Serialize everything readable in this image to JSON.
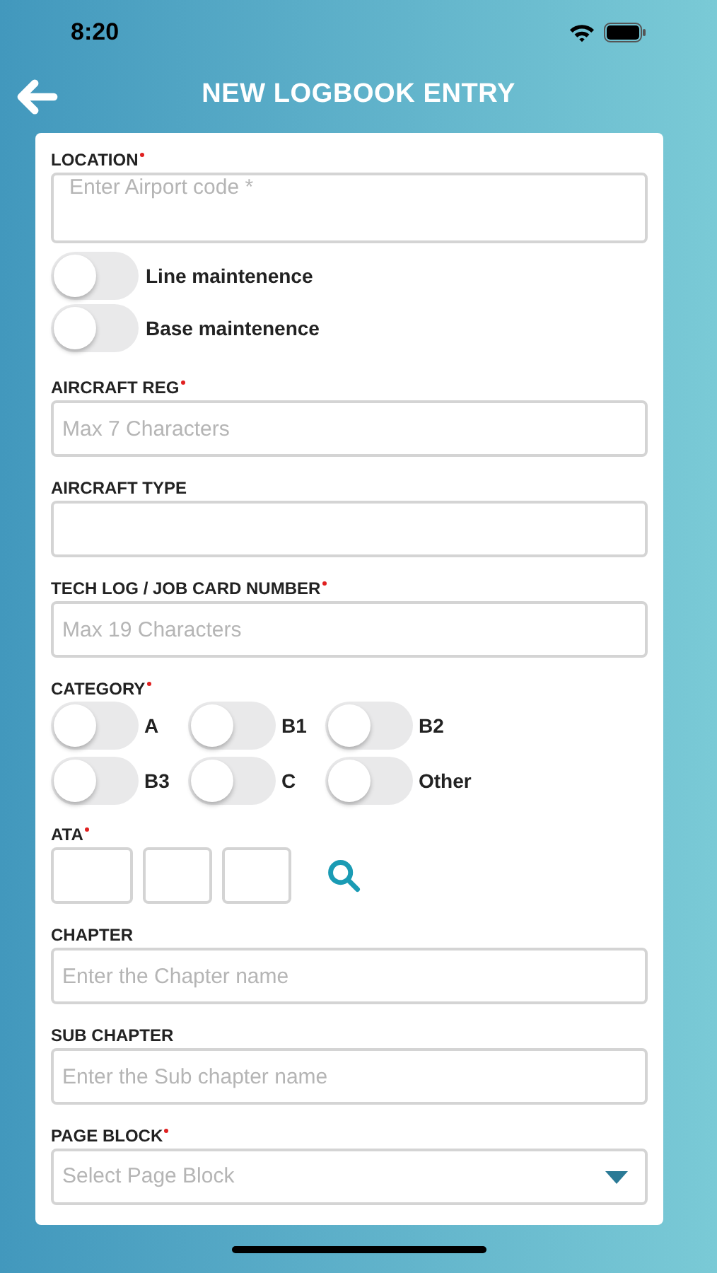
{
  "status_bar": {
    "time": "8:20"
  },
  "header": {
    "title": "NEW LOGBOOK ENTRY"
  },
  "fields": [
    {
      "kind": "multiline",
      "label": "LOCATION",
      "required": true,
      "placeholder": "Enter Airport code *"
    },
    {
      "kind": "toggles",
      "toggles": [
        {
          "label": "Line maintenence",
          "on": false
        },
        {
          "label": "Base maintenence",
          "on": false
        }
      ]
    },
    {
      "kind": "text",
      "label": "AIRCRAFT REG",
      "required": true,
      "placeholder": "Max 7 Characters"
    },
    {
      "kind": "text",
      "label": "AIRCRAFT TYPE",
      "required": false
    },
    {
      "kind": "text",
      "label": "TECH LOG / JOB CARD NUMBER",
      "required": true,
      "placeholder": "Max 19 Characters"
    },
    {
      "kind": "toggle_grid",
      "label": "CATEGORY",
      "required": true,
      "toggles": [
        {
          "label": "A",
          "on": false
        },
        {
          "label": "B1",
          "on": false
        },
        {
          "label": "B2",
          "on": false
        },
        {
          "label": "B3",
          "on": false
        },
        {
          "label": "C",
          "on": false
        },
        {
          "label": "Other",
          "on": false
        }
      ]
    },
    {
      "kind": "ata",
      "label": "ATA",
      "required": true
    },
    {
      "kind": "text",
      "label": "CHAPTER",
      "required": false,
      "placeholder": "Enter the Chapter name"
    },
    {
      "kind": "text",
      "label": "SUB CHAPTER",
      "required": false,
      "placeholder": "Enter the Sub chapter name"
    },
    {
      "kind": "select",
      "label": "PAGE BLOCK",
      "required": true,
      "placeholder": "Select Page Block"
    }
  ]
}
